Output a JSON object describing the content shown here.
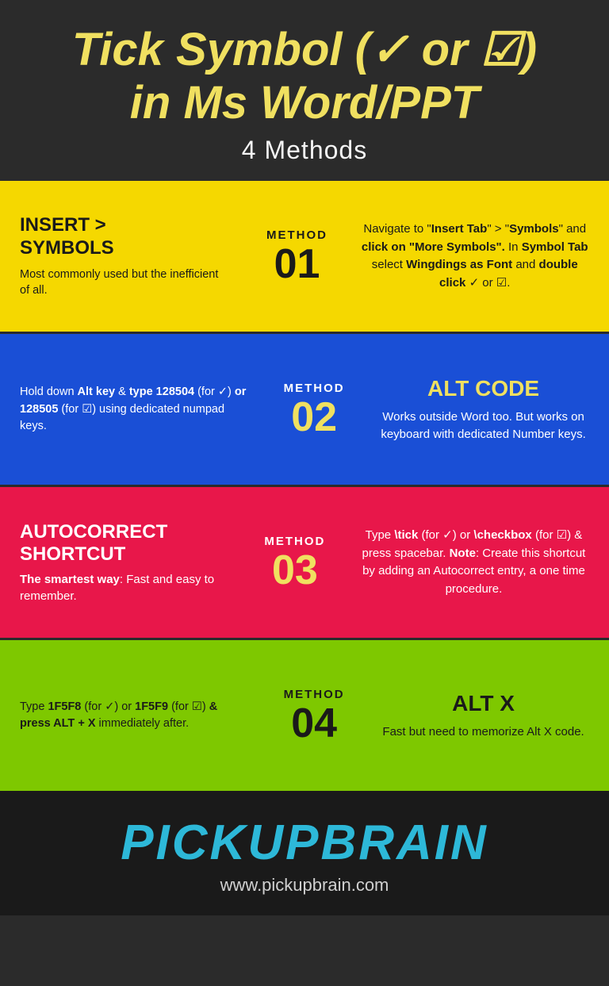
{
  "header": {
    "title": "Tick Symbol (✓ or ☑)",
    "title_line2": "in Ms Word/PPT",
    "subtitle": "4 Methods"
  },
  "methods": [
    {
      "id": "01",
      "badge_label": "METHOD",
      "badge_number": "01",
      "left_title": "INSERT > SYMBOLS",
      "left_desc": "Most commonly used but the inefficient of all.",
      "right_text_html": "Navigate to \"Insert Tab\" > \"Symbols\" and click on \"More Symbols\". In Symbol Tab select Wingdings as Font and double click ✓ or ☑."
    },
    {
      "id": "02",
      "badge_label": "METHOD",
      "badge_number": "02",
      "left_text_html": "Hold down Alt key & type 128504 (for ✓) or 128505 (for ☑) using dedicated numpad keys.",
      "right_title": "ALT CODE",
      "right_desc": "Works outside Word too. But works on keyboard with dedicated Number keys."
    },
    {
      "id": "03",
      "badge_label": "METHOD",
      "badge_number": "03",
      "left_title": "AUTOCORRECT SHORTCUT",
      "left_subtitle": "The smartest way:",
      "left_desc": "Fast and easy to remember.",
      "right_text_html": "Type \\tick (for ✓) or \\checkbox (for ☑) & press spacebar. Note: Create this shortcut by adding an Autocorrect entry, a one time procedure."
    },
    {
      "id": "04",
      "badge_label": "METHOD",
      "badge_number": "04",
      "left_text_html": "Type 1F5F8 (for ✓) or 1F5F9 (for ☑) & press ALT + X immediately after.",
      "right_title": "ALT X",
      "right_desc": "Fast but need to memorize Alt X code."
    }
  ],
  "footer": {
    "brand": "PICKUPBRAIN",
    "url": "www.pickupbrain.com"
  }
}
